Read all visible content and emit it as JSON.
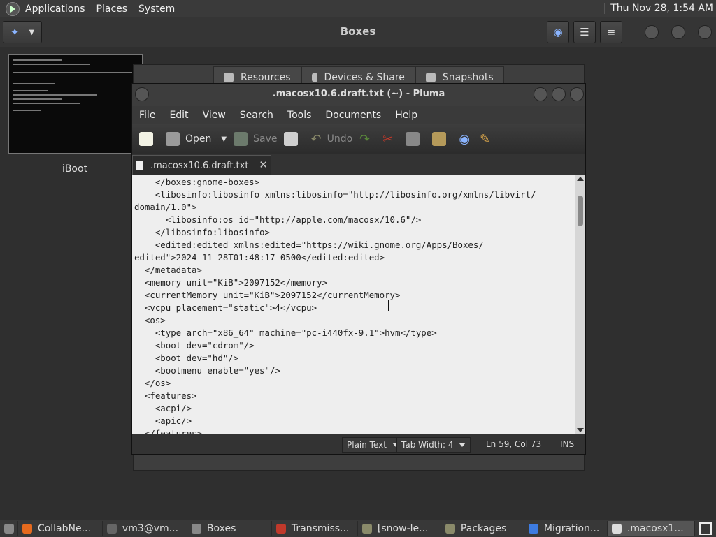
{
  "top_panel": {
    "menus": [
      "Applications",
      "Places",
      "System"
    ],
    "clock": "Thu Nov 28,  1:54 AM"
  },
  "boxes": {
    "title": "Boxes",
    "vm_name": "iBoot",
    "tabs": [
      {
        "label": "Resources",
        "icon": "gear-icon"
      },
      {
        "label": "Devices & Share",
        "icon": "mouse-icon"
      },
      {
        "label": "Snapshots",
        "icon": "snapshots-icon"
      }
    ]
  },
  "pluma": {
    "title": ".macosx10.6.draft.txt (~) - Pluma",
    "menus": [
      "File",
      "Edit",
      "View",
      "Search",
      "Tools",
      "Documents",
      "Help"
    ],
    "toolbar": {
      "open": "Open",
      "save": "Save",
      "undo": "Undo"
    },
    "tab_label": ".macosx10.6.draft.txt",
    "lines": [
      "    </boxes:gnome-boxes>",
      "    <libosinfo:libosinfo xmlns:libosinfo=\"http://libosinfo.org/xmlns/libvirt/",
      "domain/1.0\">",
      "      <libosinfo:os id=\"http://apple.com/macosx/10.6\"/>",
      "    </libosinfo:libosinfo>",
      "    <edited:edited xmlns:edited=\"https://wiki.gnome.org/Apps/Boxes/",
      "edited\">2024-11-28T01:48:17-0500</edited:edited>",
      "  </metadata>",
      "  <memory unit=\"KiB\">2097152</memory>",
      "  <currentMemory unit=\"KiB\">2097152</currentMemory>",
      "  <vcpu placement=\"static\">4</vcpu>",
      "  <os>",
      "    <type arch=\"x86_64\" machine=\"pc-i440fx-9.1\">hvm</type>",
      "    <boot dev=\"cdrom\"/>",
      "    <boot dev=\"hd\"/>",
      "    <bootmenu enable=\"yes\"/>",
      "  </os>",
      "  <features>",
      "    <acpi/>",
      "    <apic/>",
      "  </features>"
    ],
    "status": {
      "syntax": "Plain Text",
      "tab_width": "Tab Width:  4",
      "position": "Ln 59, Col 73",
      "mode": "INS"
    }
  },
  "taskbar": [
    {
      "label": "CollabNe...",
      "icon": "firefox-icon",
      "color": "#e66a1e"
    },
    {
      "label": "vm3@vm...",
      "icon": "terminal-icon",
      "color": "#666666"
    },
    {
      "label": "Boxes",
      "icon": "boxes-icon",
      "color": "#888888"
    },
    {
      "label": "Transmiss...",
      "icon": "transmission-icon",
      "color": "#c0392b"
    },
    {
      "label": "[snow-le...",
      "icon": "folder-icon",
      "color": "#8a8a6a"
    },
    {
      "label": "Packages",
      "icon": "folder-icon",
      "color": "#8a8a6a"
    },
    {
      "label": "Migration...",
      "icon": "chrome-icon",
      "color": "#3d7be0"
    },
    {
      "label": ".macosx1...",
      "icon": "text-editor-icon",
      "color": "#dddddd"
    }
  ]
}
